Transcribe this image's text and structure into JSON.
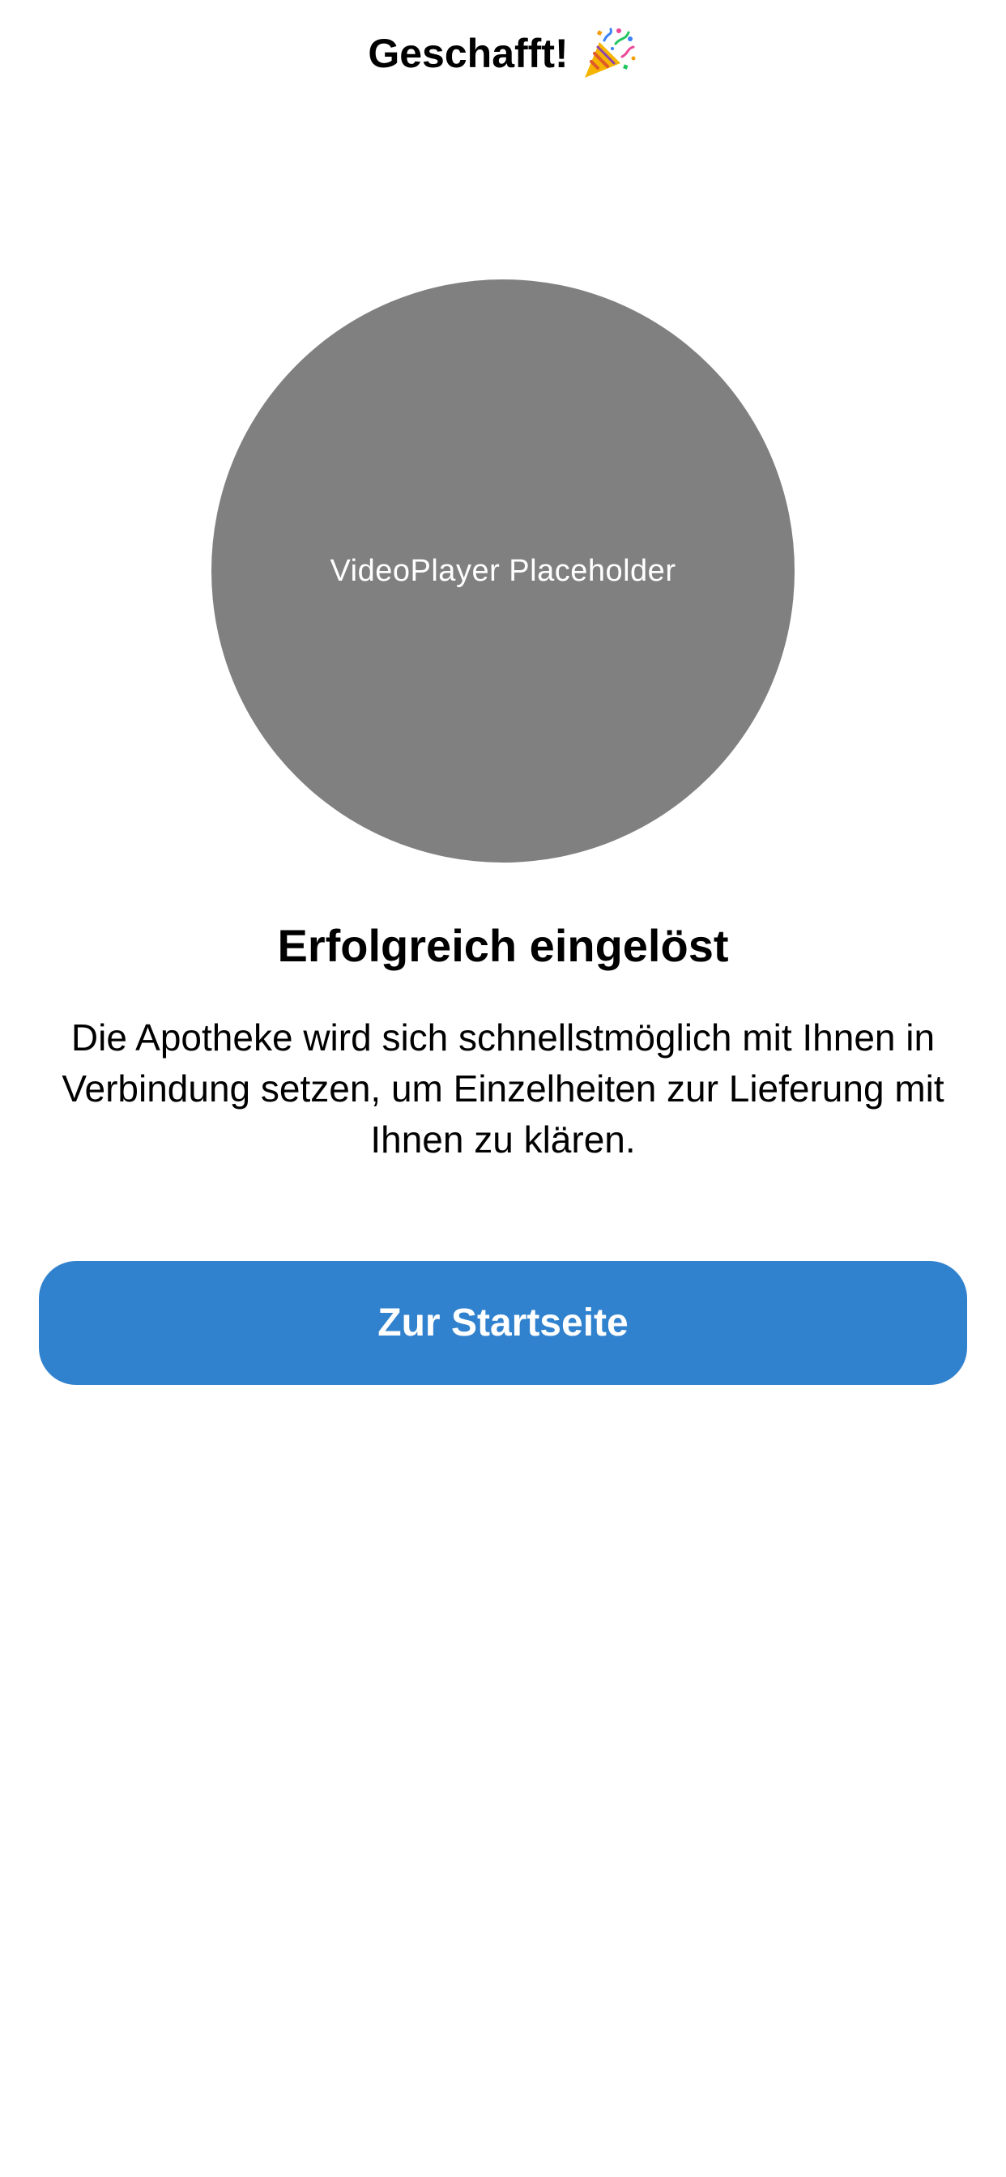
{
  "header": {
    "title": "Geschafft!",
    "title_icon": "party-popper-icon"
  },
  "video": {
    "placeholder_label": "VideoPlayer Placeholder",
    "background_color": "#808080"
  },
  "content": {
    "headline": "Erfolgreich eingelöst",
    "message": "Die Apotheke wird sich schnellstmöglich mit Ihnen in Verbindung setzen, um Einzelheiten zur Lieferung mit Ihnen zu klären."
  },
  "actions": {
    "primary_label": "Zur Startseite",
    "primary_color": "#3182ce"
  }
}
